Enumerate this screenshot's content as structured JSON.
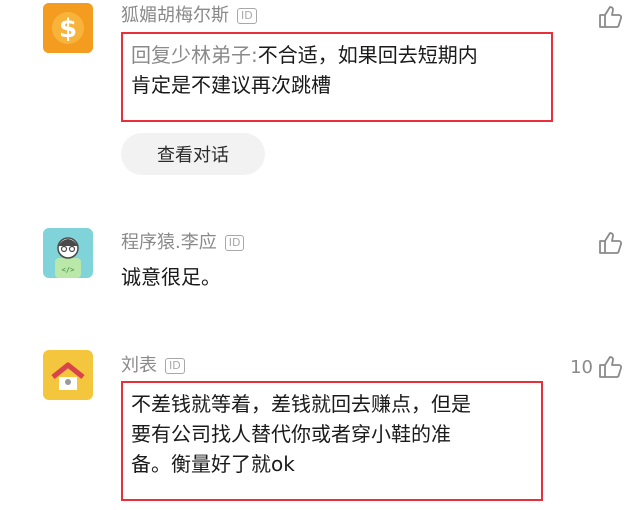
{
  "comments": [
    {
      "username": "狐媚胡梅尔斯",
      "id_badge": "ID",
      "reply_prefix": "回复少林弟子:",
      "text_line1": "不合适，如果回去短期内",
      "text_line2": "肯定是不建议再次跳槽",
      "like_count": "",
      "avatar_icon": "dollar-coin-icon",
      "avatar_color": "#f39c1f"
    },
    {
      "username": "程序猿.李应",
      "id_badge": "ID",
      "text": "诚意很足。",
      "like_count": "",
      "avatar_icon": "programmer-avatar-icon",
      "avatar_color": "#7fd3d9"
    },
    {
      "username": "刘表",
      "id_badge": "ID",
      "text_line1": "不差钱就等着，差钱就回去赚点，但是",
      "text_line2": "要有公司找人替代你或者穿小鞋的准",
      "text_line3": "备。衡量好了就ok",
      "like_count": "10",
      "avatar_icon": "house-icon",
      "avatar_color": "#f4c63d"
    }
  ],
  "view_conversation_label": "查看对话",
  "highlight_color": "#e8303a"
}
